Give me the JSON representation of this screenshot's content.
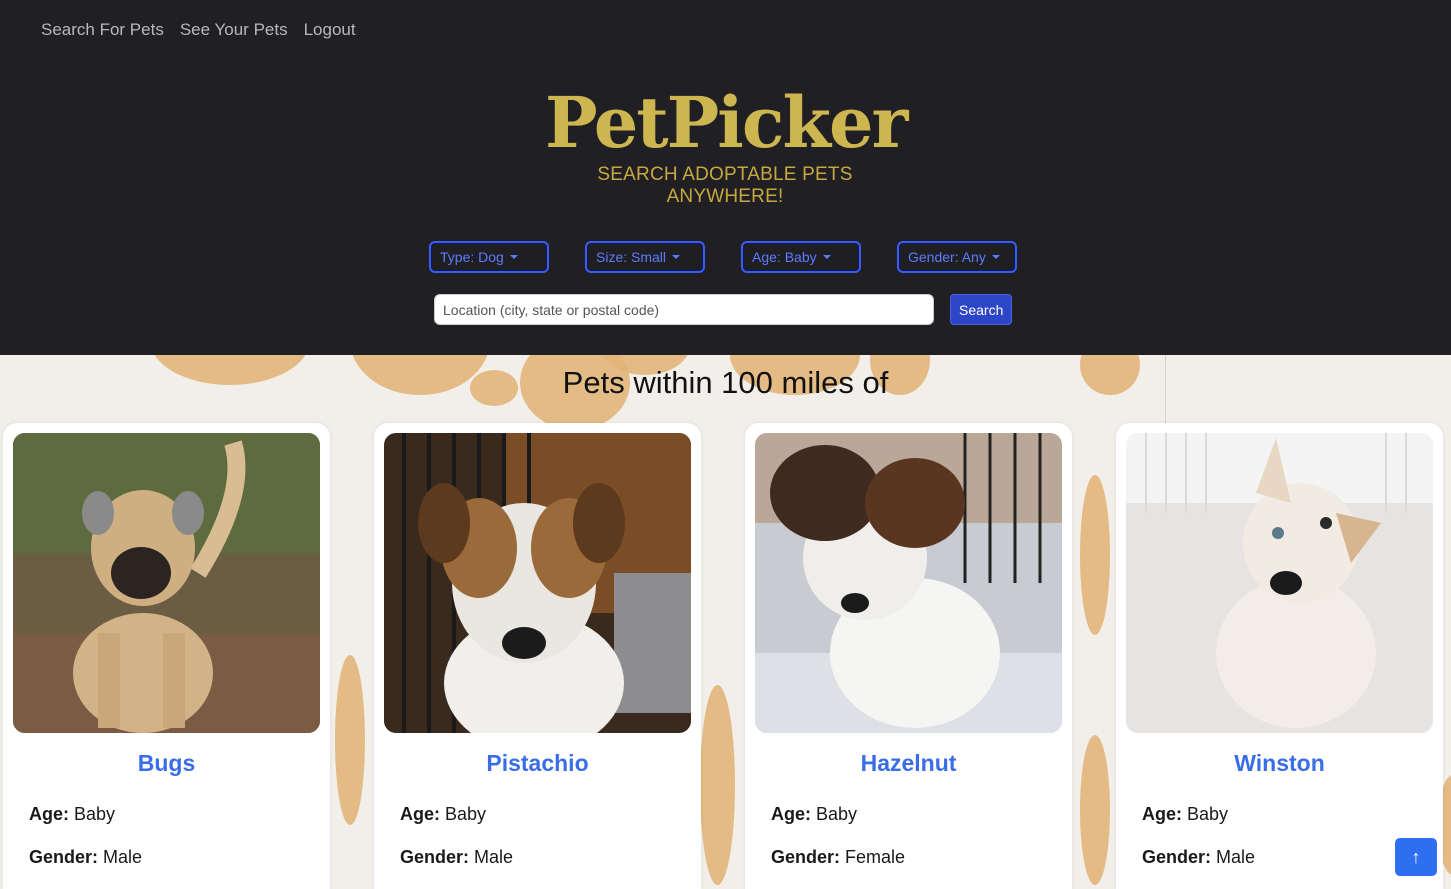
{
  "nav": {
    "items": [
      {
        "label": "Search For Pets"
      },
      {
        "label": "See Your Pets"
      },
      {
        "label": "Logout"
      }
    ]
  },
  "logo": {
    "title": "PetPicker",
    "tagline": "SEARCH ADOPTABLE PETS ANYWHERE!"
  },
  "filters": [
    {
      "label": "Type: Dog"
    },
    {
      "label": "Size: Small"
    },
    {
      "label": "Age: Baby"
    },
    {
      "label": "Gender: Any"
    }
  ],
  "search": {
    "placeholder": "Location (city, state or postal code)",
    "button_label": "Search"
  },
  "results": {
    "title": "Pets within 100 miles of"
  },
  "labels": {
    "age": "Age:",
    "gender": "Gender:"
  },
  "pets": [
    {
      "name": "Bugs",
      "age": "Baby",
      "gender": "Male"
    },
    {
      "name": "Pistachio",
      "age": "Baby",
      "gender": "Male"
    },
    {
      "name": "Hazelnut",
      "age": "Baby",
      "gender": "Female"
    },
    {
      "name": "Winston",
      "age": "Baby",
      "gender": "Male"
    }
  ],
  "scroll_top": {
    "icon": "arrow-up-icon",
    "glyph": "↑"
  },
  "colors": {
    "header_bg": "#202024",
    "accent": "#3b5bf6",
    "link": "#3a6ee8",
    "logo": "#cdb54f"
  }
}
